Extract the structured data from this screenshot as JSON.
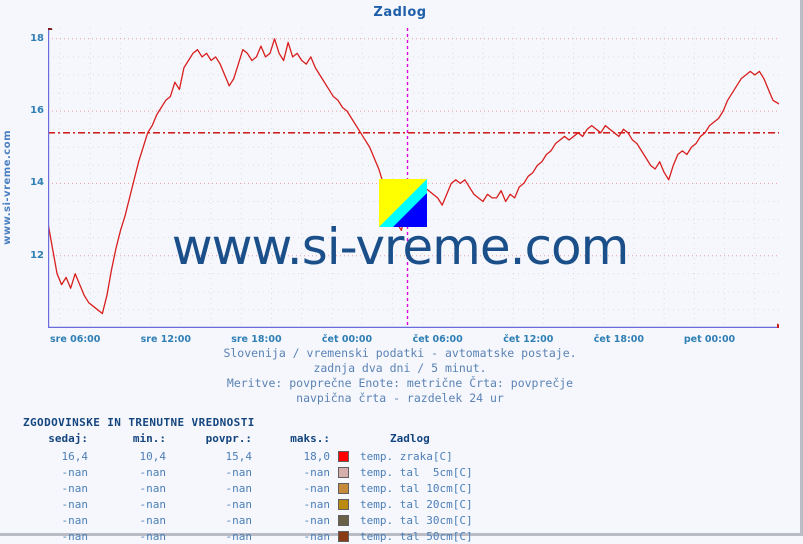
{
  "header": {
    "title": "Zadlog"
  },
  "watermark": {
    "side_text": "www.si-vreme.com",
    "center_text": "www.si-vreme.com",
    "logo_name": "si-vreme-logo"
  },
  "caption": {
    "line1": "Slovenija / vremenski podatki - avtomatske postaje.",
    "line2": "zadnja dva dni / 5 minut.",
    "line3": "Meritve: povprečne  Enote: metrične  Črta: povprečje",
    "line4": "navpična črta - razdelek 24 ur"
  },
  "table": {
    "title": "ZGODOVINSKE IN TRENUTNE VREDNOSTI",
    "headers": {
      "sedaj": "sedaj:",
      "min": "min.:",
      "povpr": "povpr.:",
      "maks": "maks.:",
      "station": "Zadlog"
    },
    "rows": [
      {
        "sedaj": "16,4",
        "min": "10,4",
        "povpr": "15,4",
        "maks": "18,0",
        "color": "#FF0000",
        "label": "temp. zraka[C]"
      },
      {
        "sedaj": "-nan",
        "min": "-nan",
        "povpr": "-nan",
        "maks": "-nan",
        "color": "#D7AEAE",
        "label": "temp. tal  5cm[C]"
      },
      {
        "sedaj": "-nan",
        "min": "-nan",
        "povpr": "-nan",
        "maks": "-nan",
        "color": "#C68A3D",
        "label": "temp. tal 10cm[C]"
      },
      {
        "sedaj": "-nan",
        "min": "-nan",
        "povpr": "-nan",
        "maks": "-nan",
        "color": "#BD8A10",
        "label": "temp. tal 20cm[C]"
      },
      {
        "sedaj": "-nan",
        "min": "-nan",
        "povpr": "-nan",
        "maks": "-nan",
        "color": "#6A6048",
        "label": "temp. tal 30cm[C]"
      },
      {
        "sedaj": "-nan",
        "min": "-nan",
        "povpr": "-nan",
        "maks": "-nan",
        "color": "#8A3A14",
        "label": "temp. tal 50cm[C]"
      }
    ]
  },
  "chart_data": {
    "type": "line",
    "title": "Zadlog",
    "xlabel": "",
    "ylabel": "",
    "grid": true,
    "legend_position": "below-table",
    "ylim": [
      10.0,
      18.3
    ],
    "yticks": [
      12,
      14,
      16,
      18
    ],
    "xticks": [
      "sre 06:00",
      "sre 12:00",
      "sre 18:00",
      "čet 00:00",
      "čet 06:00",
      "čet 12:00",
      "čet 18:00",
      "pet 00:00"
    ],
    "xtick_hours": [
      6,
      12,
      18,
      24,
      30,
      36,
      42,
      48
    ],
    "x_range_hours": [
      4.2,
      52.6
    ],
    "average_line": {
      "value": 15.4,
      "color": "#CC0000",
      "style": "dash-dot"
    },
    "day_divider": {
      "label": "navpična črta - razdelek 24 ur",
      "hours": [
        28.0
      ],
      "color": "#E000E0"
    },
    "series": [
      {
        "name": "temp. zraka[C]",
        "color": "#D81E1E",
        "unit": "C",
        "current": 16.4,
        "min": 10.4,
        "avg": 15.4,
        "max": 18.0,
        "x_hours": [
          4.2,
          4.5,
          4.8,
          5.1,
          5.4,
          5.7,
          6.0,
          6.3,
          6.6,
          6.9,
          7.2,
          7.5,
          7.8,
          8.1,
          8.4,
          8.7,
          9.0,
          9.3,
          9.6,
          9.9,
          10.2,
          10.5,
          10.8,
          11.1,
          11.4,
          11.7,
          12.0,
          12.3,
          12.6,
          12.9,
          13.2,
          13.5,
          13.8,
          14.1,
          14.4,
          14.7,
          15.0,
          15.3,
          15.6,
          15.9,
          16.2,
          16.5,
          16.8,
          17.1,
          17.4,
          17.7,
          18.0,
          18.3,
          18.6,
          18.9,
          19.2,
          19.5,
          19.8,
          20.1,
          20.4,
          20.7,
          21.0,
          21.3,
          21.6,
          21.9,
          22.2,
          22.5,
          22.8,
          23.1,
          23.4,
          23.7,
          24.0,
          24.3,
          24.6,
          24.9,
          25.2,
          25.5,
          25.8,
          26.1,
          26.4,
          26.7,
          27.0,
          27.3,
          27.6,
          27.9,
          28.2,
          28.5,
          28.8,
          29.1,
          29.4,
          29.7,
          30.0,
          30.3,
          30.6,
          30.9,
          31.2,
          31.5,
          31.8,
          32.1,
          32.4,
          32.7,
          33.0,
          33.3,
          33.6,
          33.9,
          34.2,
          34.5,
          34.8,
          35.1,
          35.4,
          35.7,
          36.0,
          36.3,
          36.6,
          36.9,
          37.2,
          37.5,
          37.8,
          38.1,
          38.4,
          38.7,
          39.0,
          39.3,
          39.6,
          39.9,
          40.2,
          40.5,
          40.8,
          41.1,
          41.4,
          41.7,
          42.0,
          42.3,
          42.6,
          42.9,
          43.2,
          43.5,
          43.8,
          44.1,
          44.4,
          44.7,
          45.0,
          45.3,
          45.6,
          45.9,
          46.2,
          46.5,
          46.8,
          47.1,
          47.4,
          47.7,
          48.0,
          48.3,
          48.6,
          48.9,
          49.2,
          49.5,
          49.8,
          50.1,
          50.4,
          50.7,
          51.0,
          51.3,
          51.6,
          51.9,
          52.2,
          52.6
        ],
        "values": [
          12.9,
          12.2,
          11.5,
          11.2,
          11.4,
          11.1,
          11.5,
          11.2,
          10.9,
          10.7,
          10.6,
          10.5,
          10.4,
          10.9,
          11.6,
          12.2,
          12.7,
          13.1,
          13.6,
          14.1,
          14.6,
          15.0,
          15.4,
          15.6,
          15.9,
          16.1,
          16.3,
          16.4,
          16.8,
          16.6,
          17.2,
          17.4,
          17.6,
          17.7,
          17.5,
          17.6,
          17.4,
          17.5,
          17.3,
          17.0,
          16.7,
          16.9,
          17.3,
          17.7,
          17.6,
          17.4,
          17.5,
          17.8,
          17.5,
          17.6,
          18.0,
          17.6,
          17.4,
          17.9,
          17.5,
          17.6,
          17.4,
          17.3,
          17.5,
          17.2,
          17.0,
          16.8,
          16.6,
          16.4,
          16.3,
          16.1,
          16.0,
          15.8,
          15.6,
          15.4,
          15.2,
          15.0,
          14.7,
          14.4,
          14.0,
          13.6,
          13.2,
          12.9,
          12.7,
          13.3,
          13.7,
          13.8,
          13.6,
          13.9,
          13.8,
          13.7,
          13.6,
          13.4,
          13.7,
          14.0,
          14.1,
          14.0,
          14.1,
          13.9,
          13.7,
          13.6,
          13.5,
          13.7,
          13.6,
          13.6,
          13.8,
          13.5,
          13.7,
          13.6,
          13.9,
          14.0,
          14.2,
          14.3,
          14.5,
          14.6,
          14.8,
          14.9,
          15.1,
          15.2,
          15.3,
          15.2,
          15.3,
          15.4,
          15.3,
          15.5,
          15.6,
          15.5,
          15.4,
          15.6,
          15.5,
          15.4,
          15.3,
          15.5,
          15.4,
          15.2,
          15.1,
          14.9,
          14.7,
          14.5,
          14.4,
          14.6,
          14.3,
          14.1,
          14.5,
          14.8,
          14.9,
          14.8,
          15.0,
          15.1,
          15.3,
          15.4,
          15.6,
          15.7,
          15.8,
          16.0,
          16.3,
          16.5,
          16.7,
          16.9,
          17.0,
          17.1,
          17.0,
          17.1,
          16.9,
          16.6,
          16.3,
          16.2,
          16.4
        ]
      }
    ]
  }
}
